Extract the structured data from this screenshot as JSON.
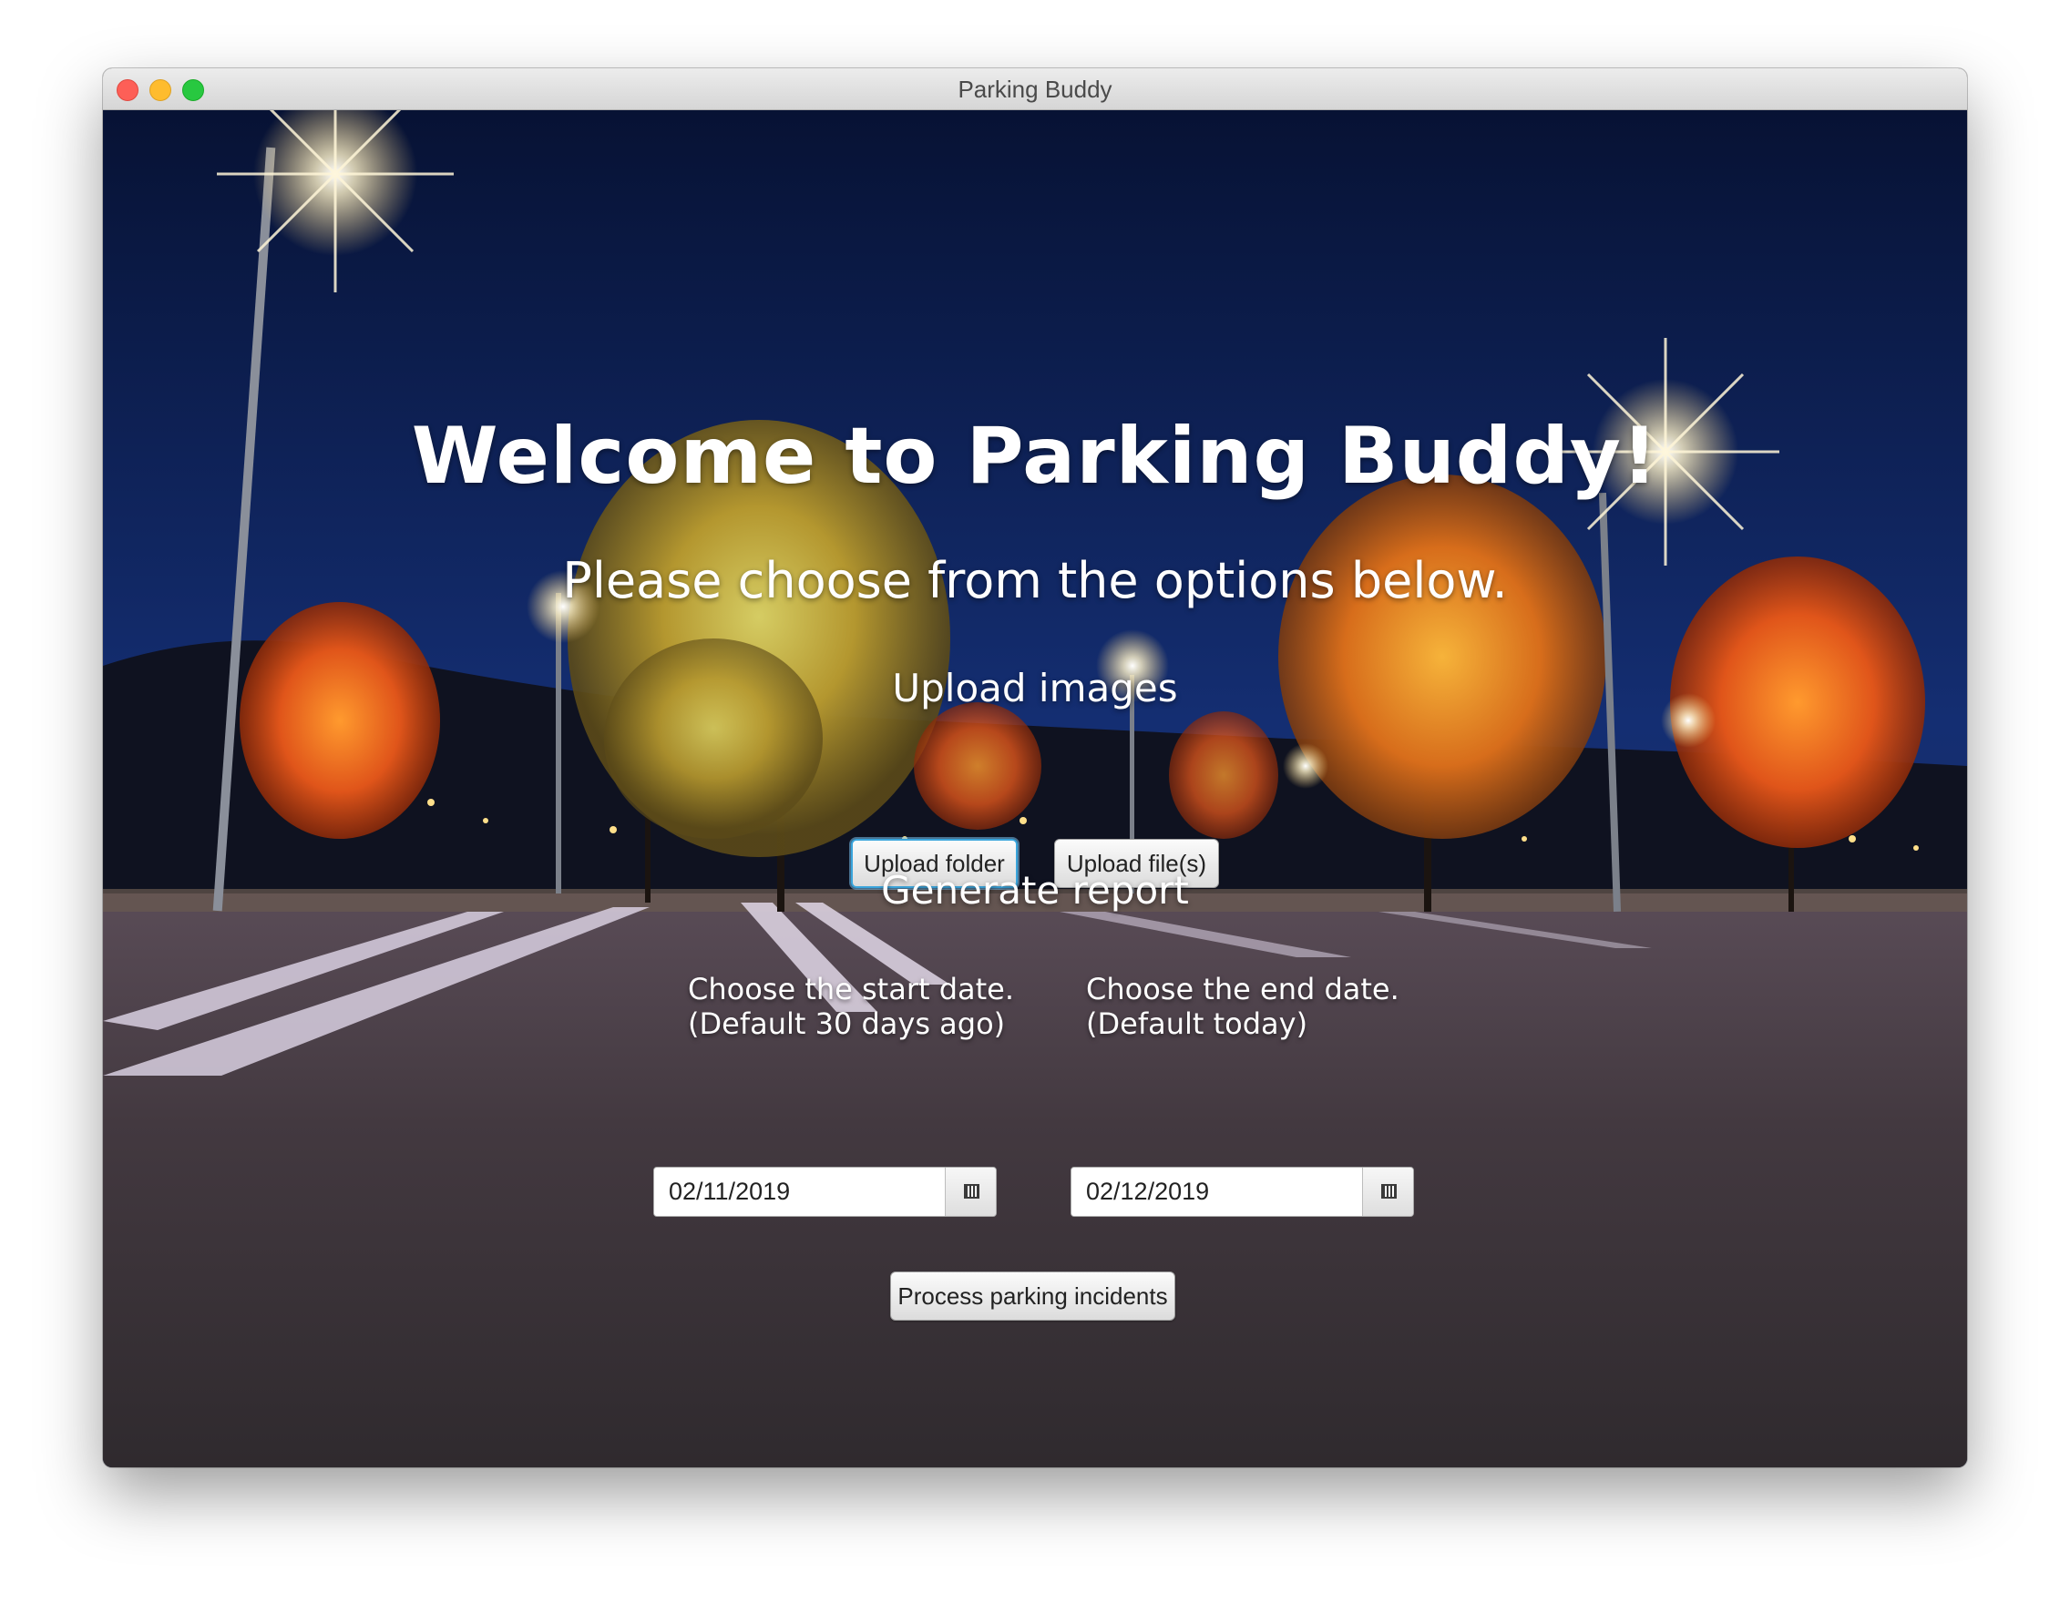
{
  "window": {
    "title": "Parking Buddy"
  },
  "main": {
    "welcome_title": "Welcome to Parking Buddy!",
    "subtitle": "Please choose from the options below.",
    "upload_section": {
      "heading": "Upload images",
      "upload_folder_label": "Upload folder",
      "upload_files_label": "Upload file(s)"
    },
    "report_section": {
      "heading": "Generate report",
      "start_date_label": "Choose the start date.\n(Default 30 days ago)",
      "end_date_label": "Choose the end date.\n(Default today)",
      "start_date_value": "02/11/2019",
      "end_date_value": "02/12/2019",
      "calendar_icon": "calendar-icon",
      "process_button_label": "Process parking incidents"
    }
  },
  "colors": {
    "accent_focus": "#3aa5dc",
    "close": "#fd5f57",
    "minimize": "#febc2e",
    "maximize": "#28c840"
  }
}
